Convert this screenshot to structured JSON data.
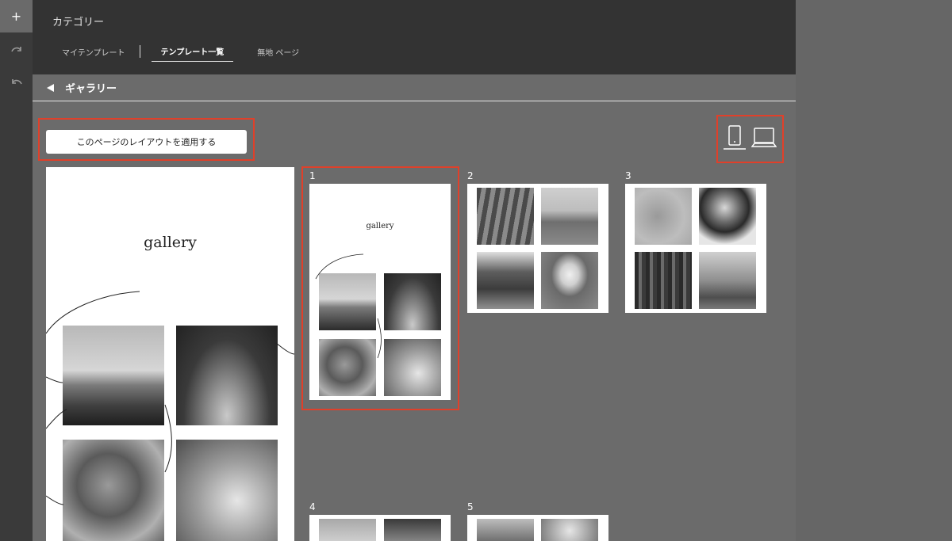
{
  "rail": {
    "add": "+"
  },
  "header": {
    "category_title": "カテゴリー",
    "tabs": [
      {
        "label": "マイテンプレート",
        "active": false
      },
      {
        "label": "テンプレート一覧",
        "active": true
      },
      {
        "label": "無地 ページ",
        "active": false
      }
    ]
  },
  "gallery_bar": {
    "label": "ギャラリー"
  },
  "apply_button": {
    "label": "このページのレイアウトを適用する"
  },
  "preview": {
    "title": "gallery"
  },
  "templates": [
    {
      "number": "1",
      "title": "gallery",
      "selected": true
    },
    {
      "number": "2",
      "title": "",
      "selected": false
    },
    {
      "number": "3",
      "title": "",
      "selected": false
    },
    {
      "number": "4",
      "title": "",
      "selected": false
    },
    {
      "number": "5",
      "title": "",
      "selected": false
    }
  ],
  "colors": {
    "highlight": "#e0402a",
    "header_bg": "#333333",
    "canvas_bg": "#6b6b6b"
  }
}
